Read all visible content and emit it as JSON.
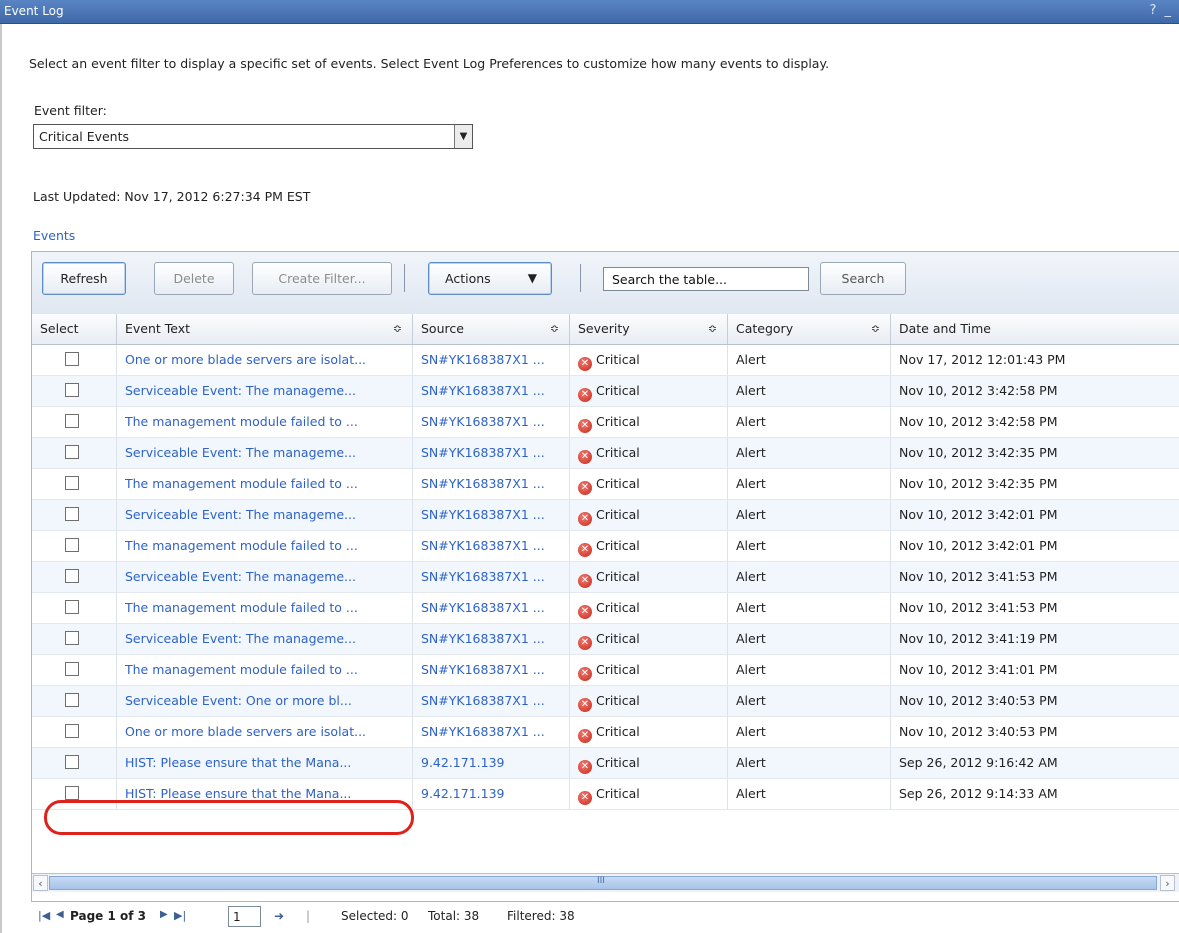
{
  "window": {
    "title": "Event Log",
    "controls": "? _"
  },
  "intro": "Select an event filter to display a specific set of events. Select Event Log Preferences to customize how many events to display.",
  "filter": {
    "label": "Event filter:",
    "value": "Critical Events"
  },
  "last_updated": "Last Updated: Nov 17, 2012 6:27:34 PM EST",
  "events_link": "Events",
  "toolbar": {
    "refresh": "Refresh",
    "delete": "Delete",
    "create_filter": "Create Filter...",
    "actions": "Actions",
    "search_placeholder": "Search the table...",
    "search": "Search"
  },
  "columns": [
    "Select",
    "Event Text",
    "Source",
    "Severity",
    "Category",
    "Date and Time"
  ],
  "rows": [
    {
      "text": "One or more blade servers are isolat...",
      "source": "SN#YK168387X1 ...",
      "severity": "Critical",
      "category": "Alert",
      "date": "Nov 17, 2012 12:01:43 PM"
    },
    {
      "text": "Serviceable Event: The manageme...",
      "source": "SN#YK168387X1 ...",
      "severity": "Critical",
      "category": "Alert",
      "date": "Nov 10, 2012 3:42:58 PM"
    },
    {
      "text": "The management module failed to ...",
      "source": "SN#YK168387X1 ...",
      "severity": "Critical",
      "category": "Alert",
      "date": "Nov 10, 2012 3:42:58 PM"
    },
    {
      "text": "Serviceable Event: The manageme...",
      "source": "SN#YK168387X1 ...",
      "severity": "Critical",
      "category": "Alert",
      "date": "Nov 10, 2012 3:42:35 PM"
    },
    {
      "text": "The management module failed to ...",
      "source": "SN#YK168387X1 ...",
      "severity": "Critical",
      "category": "Alert",
      "date": "Nov 10, 2012 3:42:35 PM"
    },
    {
      "text": "Serviceable Event: The manageme...",
      "source": "SN#YK168387X1 ...",
      "severity": "Critical",
      "category": "Alert",
      "date": "Nov 10, 2012 3:42:01 PM"
    },
    {
      "text": "The management module failed to ...",
      "source": "SN#YK168387X1 ...",
      "severity": "Critical",
      "category": "Alert",
      "date": "Nov 10, 2012 3:42:01 PM"
    },
    {
      "text": "Serviceable Event: The manageme...",
      "source": "SN#YK168387X1 ...",
      "severity": "Critical",
      "category": "Alert",
      "date": "Nov 10, 2012 3:41:53 PM"
    },
    {
      "text": "The management module failed to ...",
      "source": "SN#YK168387X1 ...",
      "severity": "Critical",
      "category": "Alert",
      "date": "Nov 10, 2012 3:41:53 PM"
    },
    {
      "text": "Serviceable Event: The manageme...",
      "source": "SN#YK168387X1 ...",
      "severity": "Critical",
      "category": "Alert",
      "date": "Nov 10, 2012 3:41:19 PM"
    },
    {
      "text": "The management module failed to ...",
      "source": "SN#YK168387X1 ...",
      "severity": "Critical",
      "category": "Alert",
      "date": "Nov 10, 2012 3:41:01 PM"
    },
    {
      "text": "Serviceable Event: One or more bl...",
      "source": "SN#YK168387X1 ...",
      "severity": "Critical",
      "category": "Alert",
      "date": "Nov 10, 2012 3:40:53 PM"
    },
    {
      "text": "One or more blade servers are isolat...",
      "source": "SN#YK168387X1 ...",
      "severity": "Critical",
      "category": "Alert",
      "date": "Nov 10, 2012 3:40:53 PM"
    },
    {
      "text": "HIST: Please ensure that the Mana...",
      "source": "9.42.171.139",
      "severity": "Critical",
      "category": "Alert",
      "date": "Sep 26, 2012 9:16:42 AM"
    },
    {
      "text": "HIST: Please ensure that the Mana...",
      "source": "9.42.171.139",
      "severity": "Critical",
      "category": "Alert",
      "date": "Sep 26, 2012 9:14:33 AM"
    }
  ],
  "pager": {
    "page_label": "Page 1 of 3",
    "page_value": "1",
    "selected": "Selected: 0",
    "total": "Total: 38",
    "filtered": "Filtered: 38"
  },
  "colors": {
    "link": "#2e62c6",
    "titlebar": "#4a74b8",
    "callout": "#e0201a",
    "critical": "#c9281b"
  }
}
